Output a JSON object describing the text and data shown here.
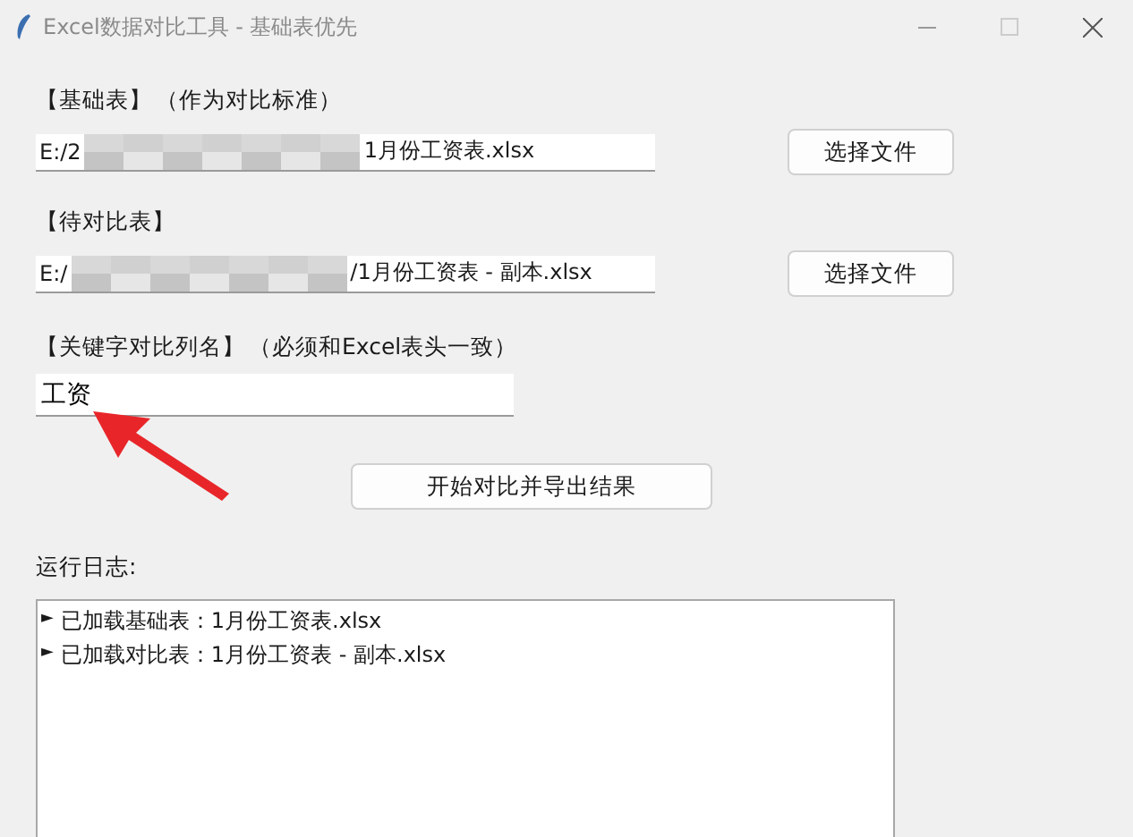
{
  "window": {
    "title": "Excel数据对比工具 - 基础表优先"
  },
  "base": {
    "label": "【基础表】",
    "note": "（作为对比标准）",
    "path_start": "E:/2",
    "path_end": "1月份工资表.xlsx",
    "button": "选择文件"
  },
  "compare": {
    "label": "【待对比表】",
    "path_start": "E:/",
    "path_end": "/1月份工资表 - 副本.xlsx",
    "button": "选择文件"
  },
  "key": {
    "label": "【关键字对比列名】",
    "note": "（必须和Excel表头一致）",
    "value": "工资"
  },
  "start_button": "开始对比并导出结果",
  "log": {
    "label": "运行日志:",
    "lines": [
      {
        "marker": "►",
        "text": "已加载基础表：1月份工资表.xlsx"
      },
      {
        "marker": "►",
        "text": "已加载对比表：1月份工资表 - 副本.xlsx"
      }
    ]
  }
}
